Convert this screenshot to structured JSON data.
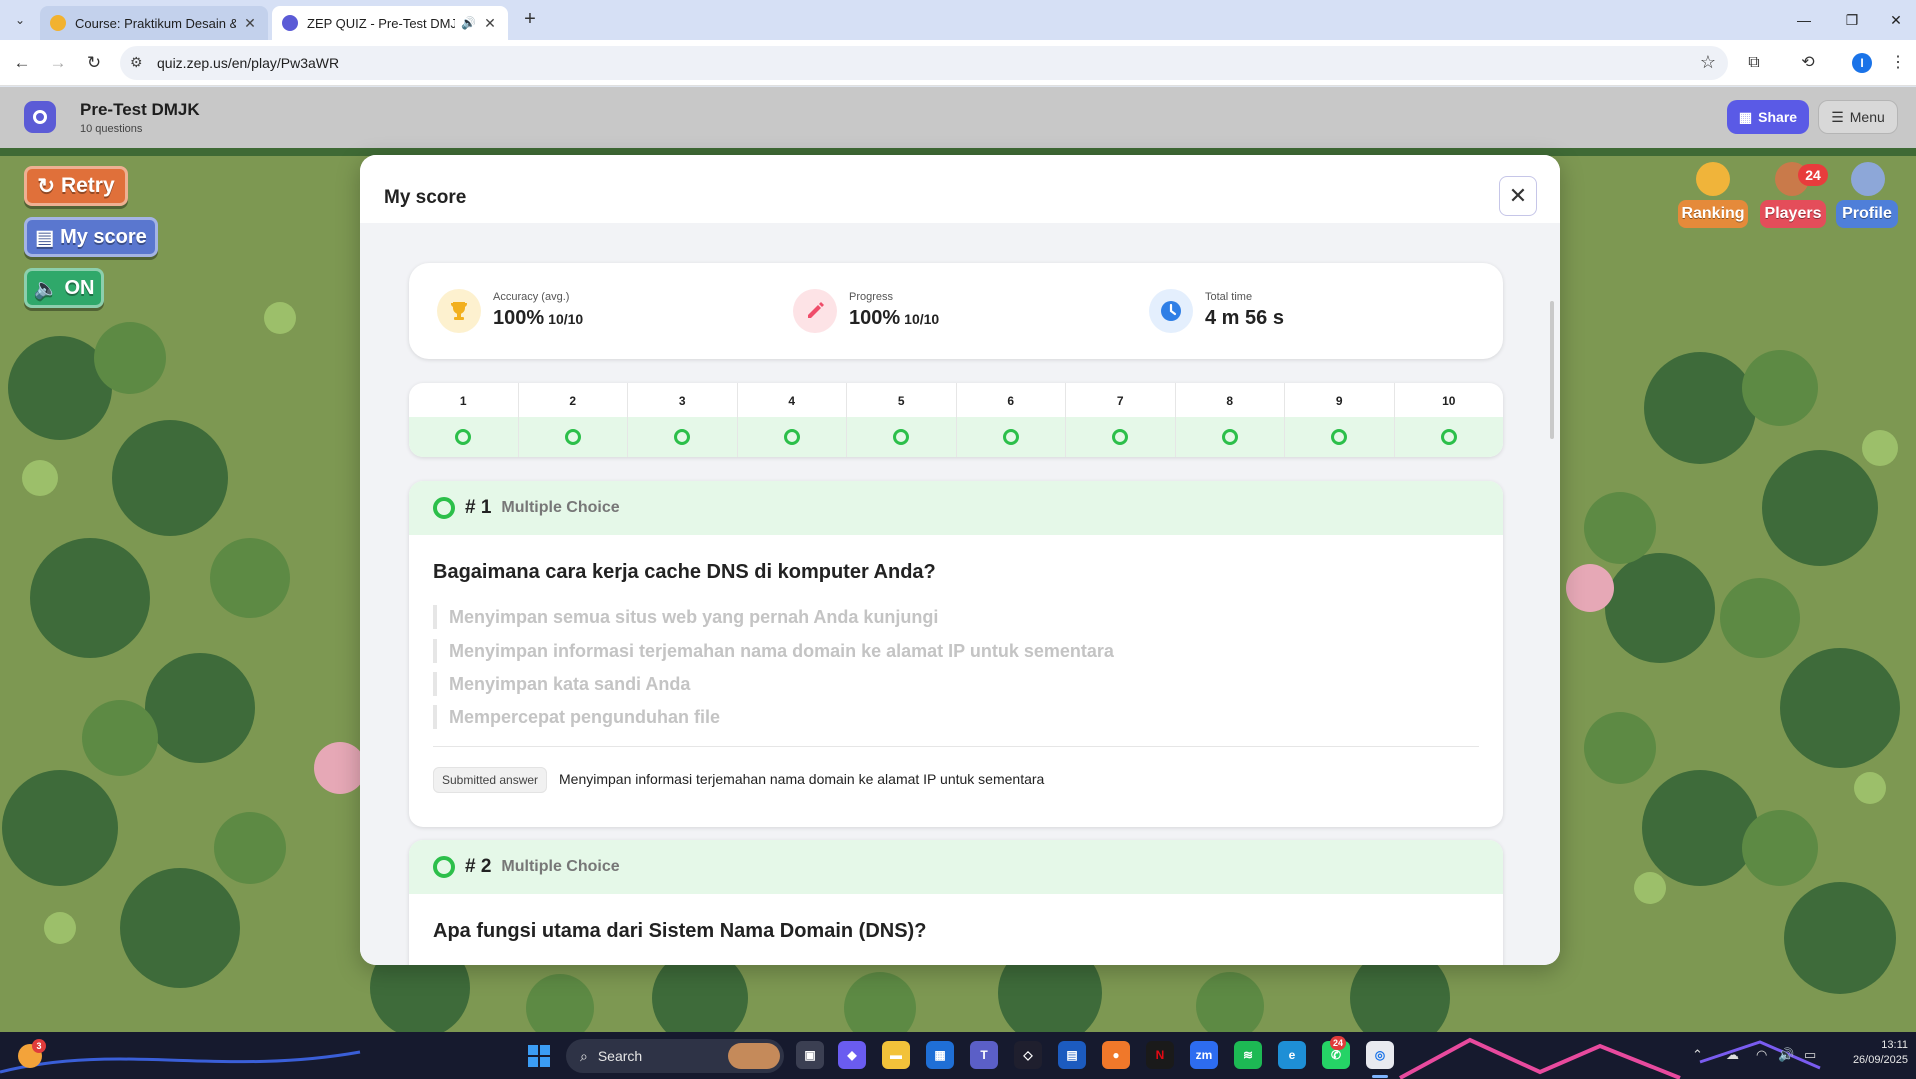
{
  "browser": {
    "tabs": [
      {
        "title": "Course: Praktikum Desain & Ma",
        "favicon_color": "#f2b22f"
      },
      {
        "title": "ZEP QUIZ - Pre-Test DMJK",
        "favicon_color": "#5b5bd6"
      }
    ],
    "url": "quiz.zep.us/en/play/Pw3aWR",
    "profile_initial": "I"
  },
  "header": {
    "title": "Pre-Test DMJK",
    "subtitle": "10 questions",
    "share_label": "Share",
    "menu_label": "Menu"
  },
  "game": {
    "retry_label": "Retry",
    "my_score_label": "My score",
    "sound_label": "ON",
    "ranking_label": "Ranking",
    "players_label": "Players",
    "players_count": "24",
    "profile_label": "Profile"
  },
  "modal": {
    "title": "My score",
    "stats": {
      "accuracy_label": "Accuracy (avg.)",
      "accuracy_value": "100%",
      "accuracy_count": "10/10",
      "progress_label": "Progress",
      "progress_value": "100%",
      "progress_count": "10/10",
      "time_label": "Total time",
      "time_value": "4 m 56 s"
    },
    "question_numbers": [
      "1",
      "2",
      "3",
      "4",
      "5",
      "6",
      "7",
      "8",
      "9",
      "10"
    ],
    "questions": [
      {
        "number": "# 1",
        "type": "Multiple Choice",
        "text": "Bagaimana cara kerja cache DNS di komputer Anda?",
        "options": [
          "Menyimpan semua situs web yang pernah Anda kunjungi",
          "Menyimpan informasi terjemahan nama domain ke alamat IP untuk sementara",
          "Menyimpan kata sandi Anda",
          "Mempercepat pengunduhan file"
        ],
        "submitted_label": "Submitted answer",
        "submitted_answer": "Menyimpan informasi terjemahan nama domain ke alamat IP untuk sementara"
      },
      {
        "number": "# 2",
        "type": "Multiple Choice",
        "text": "Apa fungsi utama dari Sistem Nama Domain (DNS)?"
      }
    ]
  },
  "taskbar": {
    "weather_badge": "3",
    "search_placeholder": "Search",
    "whatsapp_badge": "24",
    "time": "13:11",
    "date": "26/09/2025"
  }
}
